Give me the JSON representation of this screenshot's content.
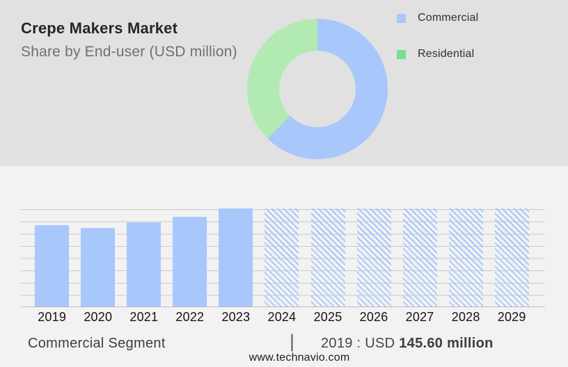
{
  "header": {
    "title": "Crepe Makers Market",
    "subtitle": "Share by End-user (USD million)"
  },
  "colors": {
    "commercial_blue": "#a8c7fa",
    "residential_green_donut": "#b1ebb3",
    "residential_green_legend": "#73e292",
    "top_background": "#e1e1e1",
    "bottom_background": "#f2f2f3",
    "gridline": "#cacaca"
  },
  "legend": {
    "items": [
      {
        "label": "Commercial",
        "color": "#a8c7fa"
      },
      {
        "label": "Residential",
        "color": "#73e292"
      }
    ]
  },
  "chart_data": [
    {
      "type": "pie",
      "subtype": "donut",
      "title": "Share by End-user (USD million)",
      "legend_position": "right",
      "segments": [
        {
          "label": "Commercial",
          "percent": 62.5,
          "color": "#a8c7fa"
        },
        {
          "label": "Residential",
          "percent": 37.5,
          "color": "#b1ebb3"
        }
      ],
      "note": "No numeric labels shown; percentages estimated from arc angles (blue starts at 12 o'clock, clockwise)."
    },
    {
      "type": "bar",
      "categories": [
        "2019",
        "2020",
        "2021",
        "2022",
        "2023",
        "2024",
        "2025",
        "2026",
        "2027",
        "2028",
        "2029"
      ],
      "series": [
        {
          "name": "Commercial segment size (USD million)",
          "values": [
            145.6,
            140.6,
            149.7,
            160.5,
            174.5,
            175,
            175,
            175,
            175,
            175,
            175
          ]
        }
      ],
      "hatched_categories": [
        "2024",
        "2025",
        "2026",
        "2027",
        "2028",
        "2029"
      ],
      "ylim": [
        0,
        175
      ],
      "grid": true,
      "xlabel": "",
      "ylabel": "",
      "bar_color": "#a8c7fa",
      "note": "Only 2019 is labeled (USD 145.60 million); other historic values estimated from bar heights against gridlines. 2024-2029 are hatched forecast placeholder bars drawn at full axis height."
    }
  ],
  "footer": {
    "segment_label": "Commercial Segment",
    "separator": "|",
    "stat_prefix": "2019 : USD",
    "stat_value": "145.60 million",
    "website": "www.technavio.com"
  }
}
